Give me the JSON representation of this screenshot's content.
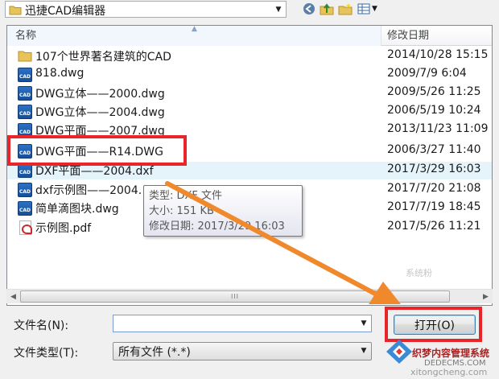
{
  "toolbar": {
    "look_in_value": "迅捷CAD编辑器"
  },
  "columns": {
    "name": "名称",
    "date_modified": "修改日期"
  },
  "files": [
    {
      "name": "107个世界著名建筑的CAD",
      "date": "2014/10/28 15:15",
      "type": "folder"
    },
    {
      "name": "818.dwg",
      "date": "2009/7/9 6:04",
      "type": "cad"
    },
    {
      "name": "DWG立体——2000.dwg",
      "date": "2009/5/26 11:25",
      "type": "cad"
    },
    {
      "name": "DWG立体——2004.dwg",
      "date": "2006/5/19 10:24",
      "type": "cad"
    },
    {
      "name": "DWG平面——2007.dwg",
      "date": "2013/11/23 11:09",
      "type": "cad"
    },
    {
      "name": "DWG平面——R14.DWG",
      "date": "2006/3/27 11:40",
      "type": "cad"
    },
    {
      "name": "DXF平面——2004.dxf",
      "date": "2017/3/29 16:03",
      "type": "cad"
    },
    {
      "name": "dxf示例图——2004.",
      "date": "2017/7/20 21:08",
      "type": "cad"
    },
    {
      "name": "简单滴图块.dwg",
      "date": "2017/7/19 18:45",
      "type": "cad"
    },
    {
      "name": "示例图.pdf",
      "date": "2017/5/26 11:21",
      "type": "pdf"
    }
  ],
  "tooltip": {
    "type_line": "类型: DXF 文件",
    "size_line": "大小: 151 KB",
    "date_line": "修改日期: 2017/3/29 16:03"
  },
  "scrollbar": {
    "thumb_grip": "III"
  },
  "form": {
    "filename_label": "文件名(N):",
    "filename_value": "",
    "filetype_label": "文件类型(T):",
    "filetype_value": "所有文件 (*.*)",
    "open_button": "打开(O)"
  },
  "icons": {
    "cad_text": "CAD"
  },
  "watermark": {
    "text1": "系统粉",
    "text2": "织梦内容管理系统",
    "text3": "DEDECMS.COM",
    "text4": "xitongcheng.com"
  },
  "colors": {
    "highlight_red": "#e8252b",
    "arrow_orange": "#f0882c",
    "cad_blue": "#1f5fae",
    "hover_row": "#e5f3fb"
  }
}
